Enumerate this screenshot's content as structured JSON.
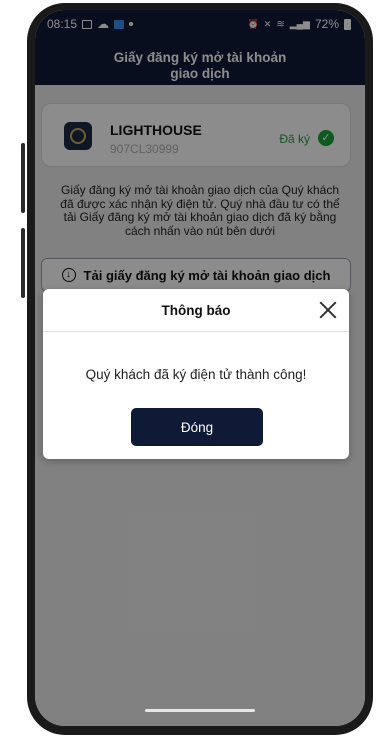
{
  "status_bar": {
    "time": "08:15",
    "right_icons": "◙ ✕ ᯤ ",
    "network": "Vo) LTE1 .ıl",
    "battery_text": "72%"
  },
  "header": {
    "title_line1": "Giấy đăng ký mở tài khoản",
    "title_line2": "giao dịch"
  },
  "account_card": {
    "company_name": "LIGHTHOUSE",
    "account_code": "907CL30999",
    "status": "Đã ký"
  },
  "description": {
    "line1": "Giấy đăng ký mở tài khoản giao dịch của Quý khách",
    "line2": "đã được xác nhận ký điện tử. Quý nhà đầu tư có thể",
    "line3": "tải Giấy đăng ký mở tài khoản giao dịch đã ký bằng",
    "line4": "cách nhấn vào nút bên dưới"
  },
  "download_button": {
    "label": "Tải giấy đăng ký mở tài khoản giao dịch"
  },
  "modal": {
    "title": "Thông báo",
    "message": "Quý khách đã ký điện tử thành công!",
    "button_label": "Đóng"
  },
  "colors": {
    "primary_navy": "#0f1a36",
    "success_green": "#1aa33a"
  }
}
